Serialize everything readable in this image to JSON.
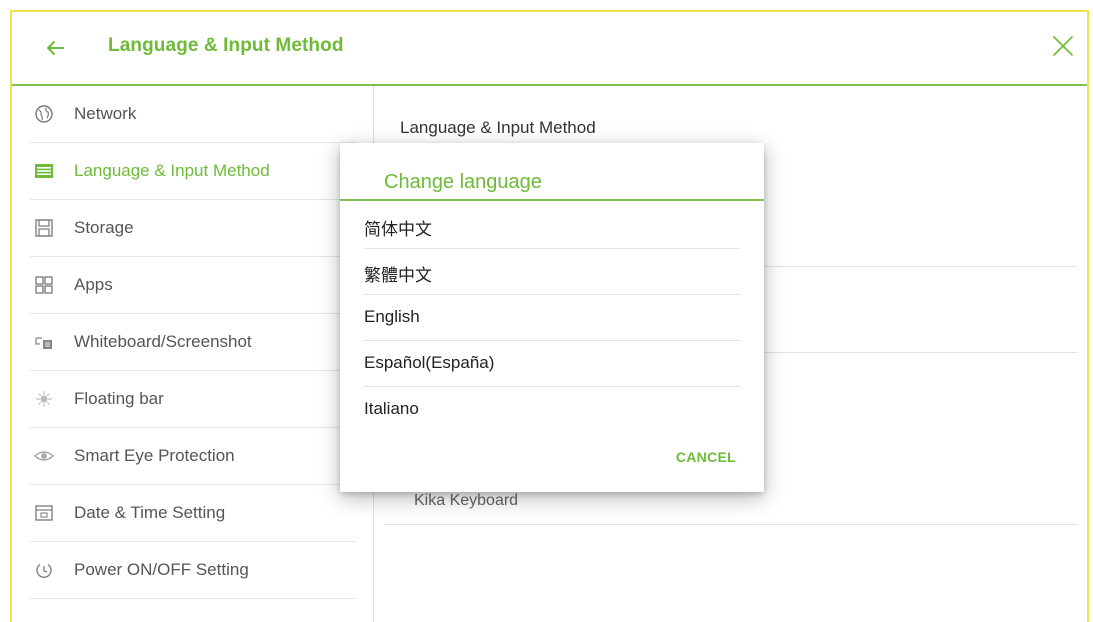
{
  "header": {
    "title": "Language & Input Method"
  },
  "sidebar": {
    "items": [
      {
        "label": "Network",
        "icon": "globe-icon"
      },
      {
        "label": "Language & Input Method",
        "icon": "keyboard-icon",
        "active": true
      },
      {
        "label": "Storage",
        "icon": "storage-icon"
      },
      {
        "label": "Apps",
        "icon": "apps-grid-icon"
      },
      {
        "label": "Whiteboard/Screenshot",
        "icon": "whiteboard-icon"
      },
      {
        "label": "Floating bar",
        "icon": "floating-bar-icon"
      },
      {
        "label": "Smart Eye Protection",
        "icon": "eye-icon"
      },
      {
        "label": "Date & Time Setting",
        "icon": "calendar-icon"
      },
      {
        "label": "Power ON/OFF Setting",
        "icon": "power-icon"
      }
    ]
  },
  "content": {
    "heading": "Language & Input Method",
    "partial_text": "Kika Keyboard"
  },
  "dialog": {
    "title": "Change language",
    "options": [
      "简体中文",
      "繁體中文",
      "English",
      "Español(España)",
      "Italiano"
    ],
    "cancel_label": "CANCEL"
  },
  "colors": {
    "accent": "#6dbb36",
    "frame_border": "#f0e24a",
    "text": "#333333"
  }
}
